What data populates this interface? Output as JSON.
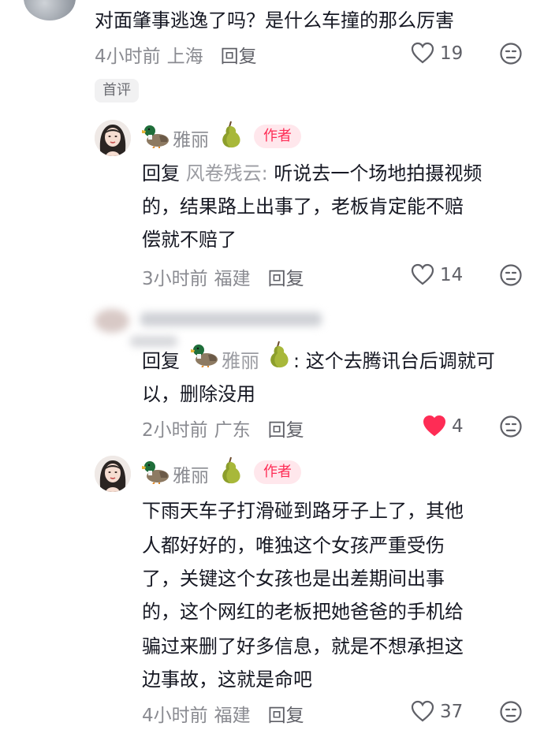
{
  "comments": [
    {
      "text": "对面肇事逃逸了吗？是什么车撞的那么厉害",
      "time": "4小时前",
      "location": "上海",
      "reply_label": "回复",
      "likes": "19",
      "tag": "首评"
    },
    {
      "author": "雅丽",
      "badge": "作者",
      "reply_prefix": "回复",
      "reply_target": "风卷残云:",
      "lines": [
        "听说去一个场地拍摄视频",
        "的，结果路上出事了，老板肯定能不赔",
        "偿就不赔了"
      ],
      "time": "3小时前",
      "location": "福建",
      "reply_label": "回复",
      "likes": "14"
    },
    {
      "reply_prefix": "回复",
      "reply_target": "雅丽",
      "lines": [
        ": 这个去腾讯台后调就可",
        "以，删除没用"
      ],
      "time": "2小时前",
      "location": "广东",
      "reply_label": "回复",
      "likes": "4",
      "liked": true
    },
    {
      "author": "雅丽",
      "badge": "作者",
      "lines": [
        "下雨天车子打滑碰到路牙子上了，其他",
        "人都好好的，唯独这个女孩严重受伤",
        "了，关键这个女孩也是出差期间出事",
        "的，这个网红的老板把她爸爸的手机给",
        "骗过来删了好多信息，就是不想承担这",
        "边事故，这就是命吧"
      ],
      "time": "4小时前",
      "location": "福建",
      "reply_label": "回复",
      "likes": "37"
    }
  ],
  "colors": {
    "liked": "#fe2c55",
    "muted": "#8a8b91",
    "badge": "#fe2c55"
  }
}
